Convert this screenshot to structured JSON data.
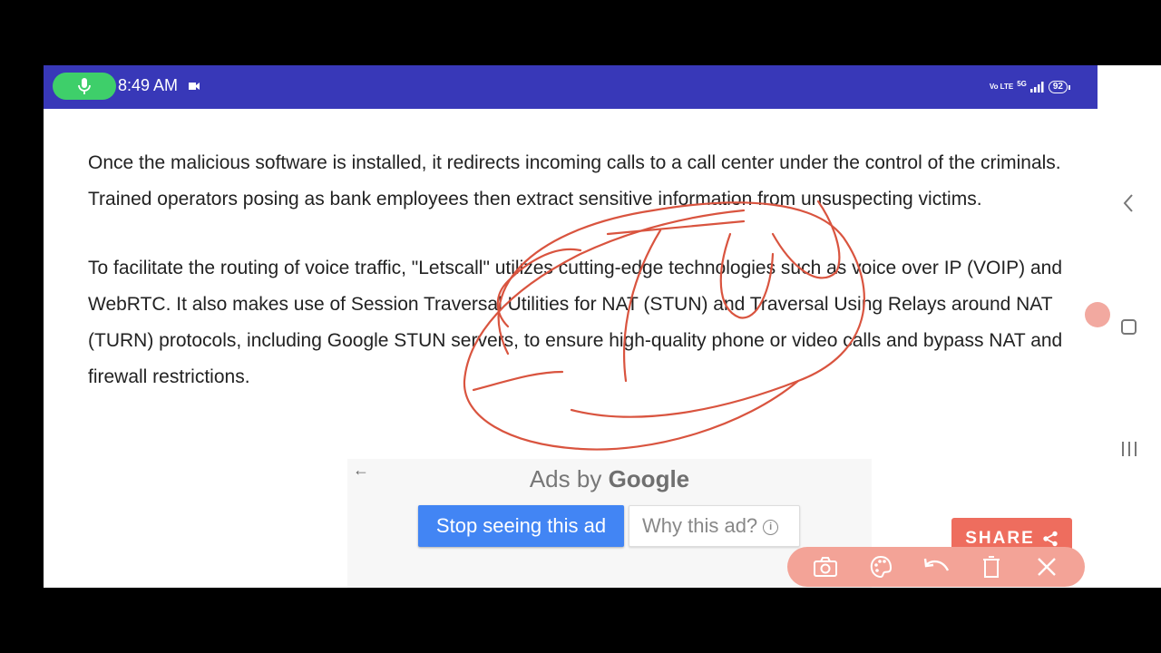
{
  "status_bar": {
    "time": "8:49 AM",
    "network_volte": "Vo LTE",
    "network_5g": "5G",
    "battery": "92",
    "accent_color": "#3838b8"
  },
  "article": {
    "paragraphs": [
      "Once the malicious software is installed, it redirects incoming calls to a call center under the control of the criminals. Trained operators posing as bank employees then extract sensitive information from unsuspecting victims.",
      "To facilitate the routing of voice traffic, \"Letscall\" utilizes cutting-edge technologies such as voice over IP (VOIP) and WebRTC. It also makes use of Session Traversal Utilities for NAT (STUN) and Traversal Using Relays around NAT (TURN) protocols, including Google STUN servers, to ensure high-quality phone or video calls and bypass NAT and firewall restrictions."
    ]
  },
  "ad": {
    "ads_by": "Ads by",
    "google": "Google",
    "stop_label": "Stop seeing this ad",
    "why_label": "Why this ad?",
    "info_glyph": "i",
    "back_glyph": "←"
  },
  "share": {
    "label": "SHARE"
  },
  "icons": {
    "mic": "mic-icon",
    "camera": "video-camera-icon",
    "share": "share-icon",
    "screenshot": "camera-icon",
    "palette": "palette-icon",
    "undo": "undo-icon",
    "delete": "trash-icon",
    "close": "close-icon",
    "nav_back": "back-chevron-icon",
    "nav_home": "home-square-icon",
    "nav_recent": "recent-apps-icon"
  },
  "annotation": {
    "handwritten": "TURN",
    "ink_color": "#d9543f"
  },
  "colors": {
    "ad_button": "#4285f4",
    "share_button": "#ee6d5e",
    "toolbar": "#f3a397"
  }
}
